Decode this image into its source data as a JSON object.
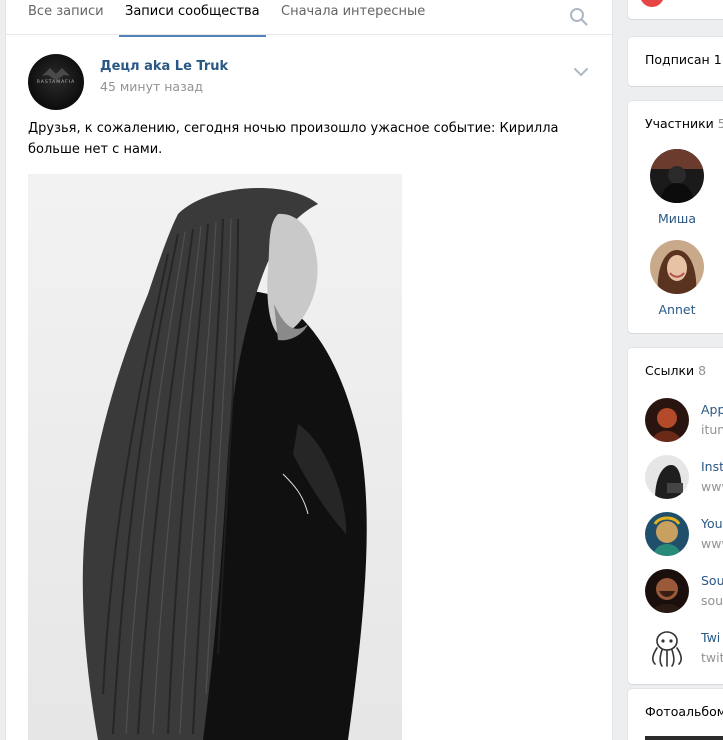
{
  "tabs": [
    {
      "label": "Все записи",
      "active": false
    },
    {
      "label": "Записи сообщества",
      "active": true
    },
    {
      "label": "Сначала интересные",
      "active": false
    }
  ],
  "post": {
    "author": "Децл aka Le Truk",
    "time": "45 минут назад",
    "avatar_text": "RASTAMAFIA",
    "text": "Друзья, к сожалению, сегодня ночью произошло ужасное событие: Кирилла больше нет с нами."
  },
  "sidebar": {
    "subscribed": {
      "label": "Подписан",
      "count": "1"
    },
    "members": {
      "title": "Участники",
      "count": "5",
      "items": [
        {
          "name": "Миша"
        },
        {
          "name": "Annet"
        }
      ]
    },
    "links": {
      "title": "Ссылки",
      "count": "8",
      "items": [
        {
          "title": "App",
          "sub": "itun"
        },
        {
          "title": "Inst",
          "sub": "www"
        },
        {
          "title": "You",
          "sub": "www"
        },
        {
          "title": "Sou",
          "sub": "sou"
        },
        {
          "title": "Twi",
          "sub": "twit"
        }
      ]
    },
    "albums": {
      "title": "Фотоальбом"
    }
  },
  "colors": {
    "link": "#2a5885",
    "accent": "#5181b8",
    "muted": "#939393",
    "background": "#edeef0"
  }
}
